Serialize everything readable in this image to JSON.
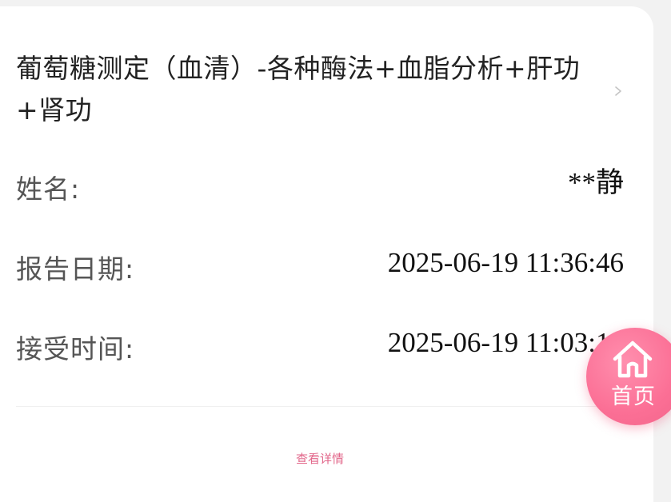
{
  "report": {
    "title": "葡萄糖测定（血清）-各种酶法+血脂分析+肝功+肾功",
    "fields": [
      {
        "label": "姓名:",
        "value": "**静"
      },
      {
        "label": "报告日期:",
        "value": "2025-06-19 11:36:46"
      },
      {
        "label": "接受时间:",
        "value": "2025-06-19 11:03:14"
      }
    ],
    "detail_link": "查看详情"
  },
  "fab": {
    "label": "首页",
    "icon": "home-icon",
    "color": "#fb6f95"
  },
  "colors": {
    "accent": "#e2668a",
    "page_bg": "#f2f2f2",
    "card_bg": "#ffffff"
  }
}
